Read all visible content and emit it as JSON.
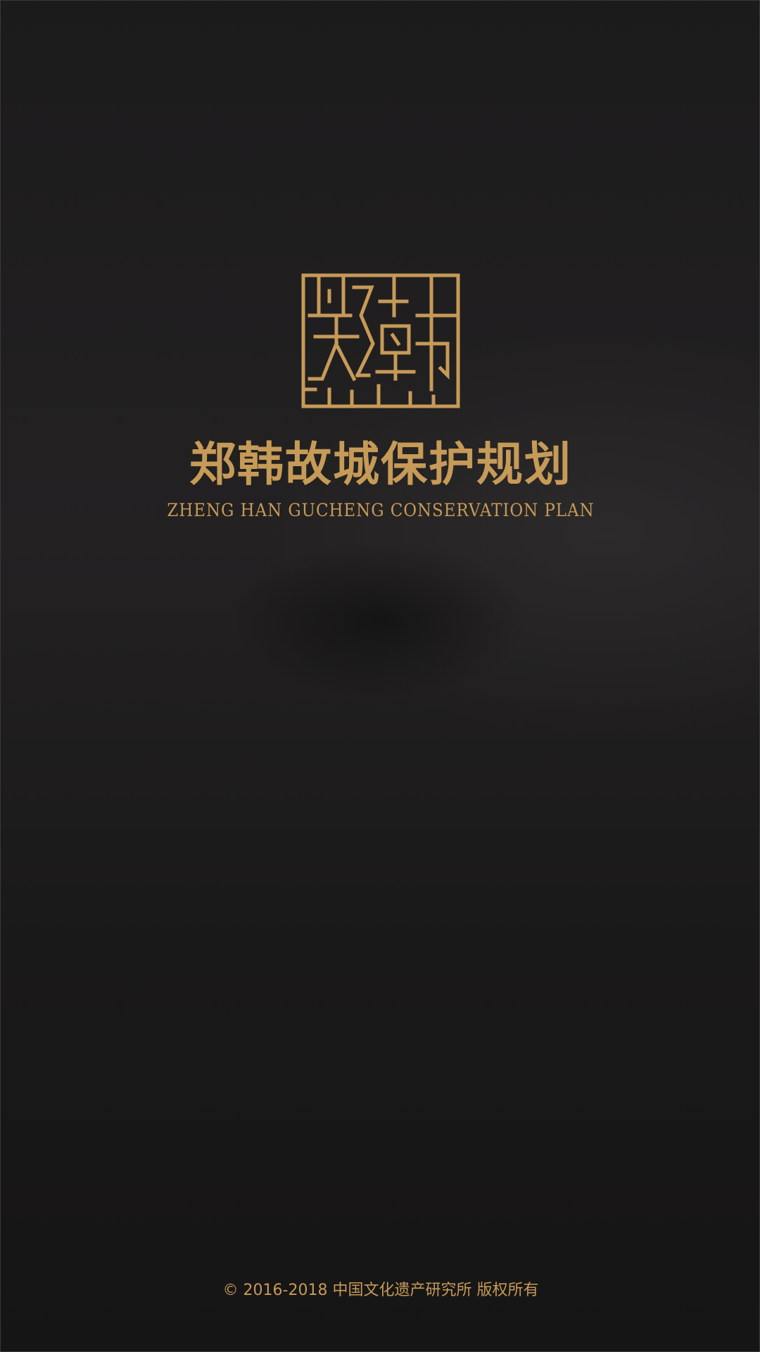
{
  "brand": {
    "logo_icon": "seal-logo-icon",
    "logo_text": "郑韩",
    "title_cn": "郑韩故城保护规划",
    "title_en": "ZHENG HAN GUCHENG CONSERVATION PLAN",
    "accent_color": "#c69a57"
  },
  "footer": {
    "copyright": "© 2016-2018 中国文化遗产研究所 版权所有"
  }
}
